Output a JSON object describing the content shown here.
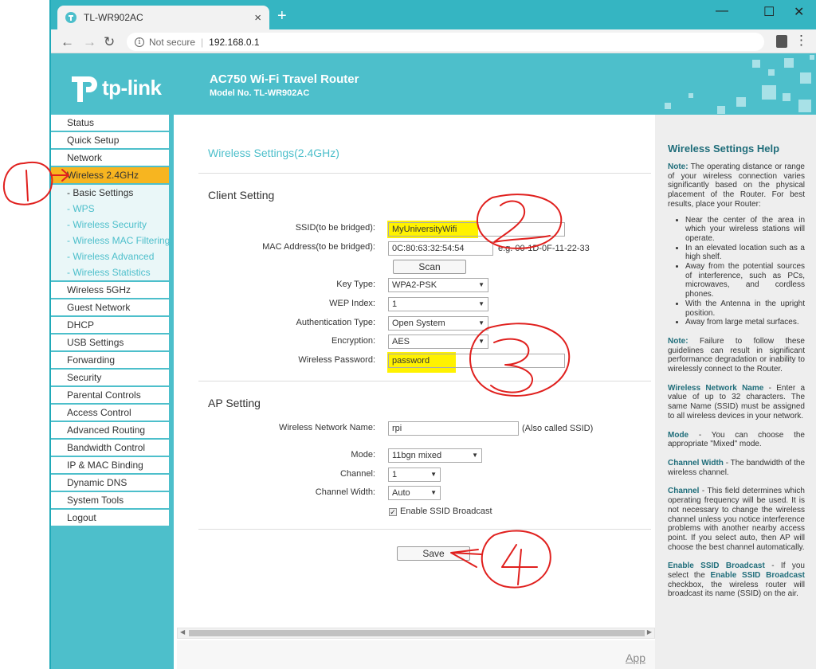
{
  "browser": {
    "tab_title": "TL-WR902AC",
    "new_tab": "+",
    "security_label": "Not secure",
    "url": "192.168.0.1"
  },
  "header": {
    "logo_text": "tp-link",
    "product_title": "AC750 Wi-Fi Travel Router",
    "model_no": "Model No. TL-WR902AC"
  },
  "sidebar": {
    "items_top": [
      "Status",
      "Quick Setup",
      "Network"
    ],
    "active_item": "Wireless 2.4GHz",
    "sub_items": [
      "- Basic Settings",
      "- WPS",
      "- Wireless Security",
      "- Wireless MAC Filtering",
      "- Wireless Advanced",
      "- Wireless Statistics"
    ],
    "items_bottom": [
      "Wireless 5GHz",
      "Guest Network",
      "DHCP",
      "USB Settings",
      "Forwarding",
      "Security",
      "Parental Controls",
      "Access Control",
      "Advanced Routing",
      "Bandwidth Control",
      "IP & MAC Binding",
      "Dynamic DNS",
      "System Tools",
      "Logout"
    ]
  },
  "main": {
    "page_title": "Wireless Settings(2.4GHz)",
    "client": {
      "section_title": "Client Setting",
      "ssid_label": "SSID(to be bridged):",
      "ssid_value": "MyUniversityWifi",
      "mac_label": "MAC Address(to be bridged):",
      "mac_value": "0C:80:63:32:54:54",
      "mac_hint": "e.g. 00-1D-0F-11-22-33",
      "scan_label": "Scan",
      "key_type_label": "Key Type:",
      "key_type_value": "WPA2-PSK",
      "wep_index_label": "WEP Index:",
      "wep_index_value": "1",
      "auth_type_label": "Authentication Type:",
      "auth_type_value": "Open System",
      "encryption_label": "Encryption:",
      "encryption_value": "AES",
      "password_label": "Wireless Password:",
      "password_value": "password"
    },
    "ap": {
      "section_title": "AP Setting",
      "network_name_label": "Wireless Network Name:",
      "network_name_value": "rpi",
      "network_name_hint": "(Also called SSID)",
      "mode_label": "Mode:",
      "mode_value": "11bgn mixed",
      "channel_label": "Channel:",
      "channel_value": "1",
      "channel_width_label": "Channel Width:",
      "channel_width_value": "Auto",
      "ssid_broadcast_label": "Enable SSID Broadcast",
      "ssid_broadcast_checked": true
    },
    "save_label": "Save",
    "app_link": "App"
  },
  "help": {
    "title": "Wireless Settings Help",
    "note1_key": "Note:",
    "note1": "The operating distance or range of your wireless connection varies significantly based on the physical placement of the Router. For best results, place your Router:",
    "tips": [
      "Near the center of the area in which your wireless stations will operate.",
      "In an elevated location such as a high shelf.",
      "Away from the potential sources of interference, such as PCs, microwaves, and cordless phones.",
      "With the Antenna in the upright position.",
      "Away from large metal surfaces."
    ],
    "note2_key": "Note:",
    "note2": "Failure to follow these guidelines can result in significant performance degradation or inability to wirelessly connect to the Router.",
    "name_key": "Wireless Network Name",
    "name_text": "- Enter a value of up to 32 characters. The same Name (SSID) must be assigned to all wireless devices in your network.",
    "mode_key": "Mode",
    "mode_text": "- You can choose the appropriate \"Mixed\" mode.",
    "width_key": "Channel Width",
    "width_text": "- The bandwidth of the wireless channel.",
    "channel_key": "Channel",
    "channel_text": "- This field determines which operating frequency will be used. It is not necessary to change the wireless channel unless you notice interference problems with another nearby access point. If you select auto, then AP will choose the best channel automatically.",
    "broadcast_key": "Enable SSID Broadcast",
    "broadcast_text_a": "- If you select the",
    "broadcast_inline_key": "Enable SSID Broadcast",
    "broadcast_text_b": "checkbox, the wireless router will broadcast its name (SSID) on the air."
  },
  "colors": {
    "brand_teal": "#4dbfcb",
    "active_menu": "#f7b520",
    "highlight": "#fff200",
    "annotation": "#e0201e"
  }
}
